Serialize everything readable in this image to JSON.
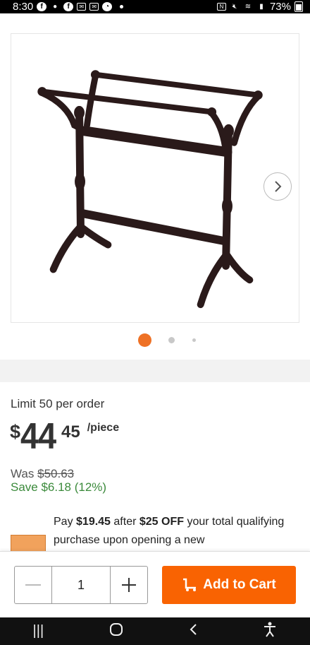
{
  "status_bar": {
    "time": "8:30",
    "battery": "73%"
  },
  "gallery": {
    "pager_count": 3,
    "active_index": 0
  },
  "product": {
    "limit": "Limit 50 per order",
    "price_symbol": "$",
    "price_whole": "44",
    "price_cents": "45",
    "price_unit": "/piece",
    "was_label": "Was",
    "was_price": "$50.63",
    "save_text": "Save $6.18 (12%)"
  },
  "offer": {
    "pre": "Pay ",
    "amount": "$19.45",
    "mid": " after ",
    "discount": "$25 OFF",
    "post": " your total qualifying purchase upon opening a new"
  },
  "cart": {
    "quantity": "1",
    "add_label": "Add to Cart"
  },
  "colors": {
    "accent": "#f96302",
    "save_green": "#3b8a3b"
  }
}
